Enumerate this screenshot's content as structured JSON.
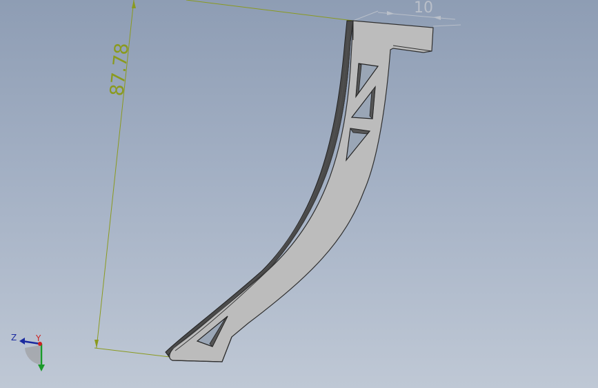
{
  "dimensions": {
    "vertical": "87.78",
    "horizontal": "10"
  },
  "triad": {
    "z_label": "Z",
    "y_label": "Y"
  },
  "colors": {
    "background_top": "#8e9db4",
    "background_bottom": "#bfc8d5",
    "part_face": "#bcbcbc",
    "part_edge": "#2e2e2e",
    "dimension_line": "#8a9a1e",
    "axis_x": "#cc2222",
    "axis_y": "#1a9a2a",
    "axis_z": "#1a2aa0"
  }
}
